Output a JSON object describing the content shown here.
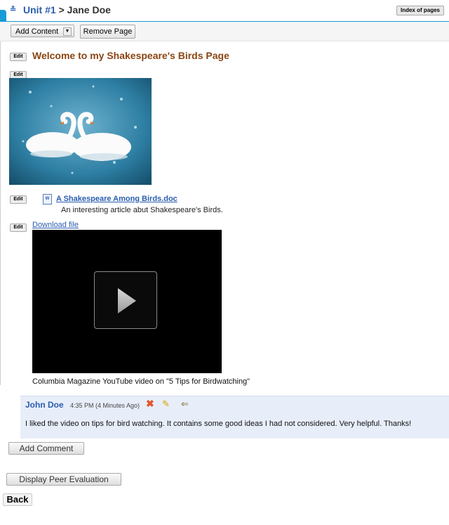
{
  "header": {
    "unit_link": "Unit #1",
    "separator": ">",
    "user_name": "Jane Doe",
    "index_button": "Index of pages"
  },
  "toolbar": {
    "add_content": "Add Content",
    "remove_page": "Remove Page"
  },
  "edit_label": "Edit",
  "page": {
    "title": "Welcome to my Shakespeare's Birds Page"
  },
  "attachment": {
    "file_link": "A Shakespeare Among Birds.doc",
    "description": "An interesting article abut Shakespeare's Birds."
  },
  "video": {
    "download_link": "Download file",
    "caption": "Columbia Magazine YouTube video on \"5 Tips for Birdwatching\""
  },
  "comment": {
    "author": "John Doe",
    "time": "4:35 PM (4 Minutes Ago)",
    "text": "I liked the video on tips for bird watching. It contains some good ideas I had not considered. Very helpful. Thanks!"
  },
  "buttons": {
    "add_comment": "Add Comment",
    "display_peer_evaluation": "Display Peer Evaluation",
    "back": "Back"
  },
  "colors": {
    "accent": "#1a9ad6",
    "link": "#2a5db0",
    "title": "#8a4513",
    "comment_bg": "#e8eef9"
  },
  "icons": [
    "sidebar-toggle-icon",
    "unit-icon",
    "dropdown-arrow-icon",
    "word-doc-icon",
    "play-icon",
    "delete-icon",
    "pencil-icon",
    "reply-arrow-icon"
  ]
}
